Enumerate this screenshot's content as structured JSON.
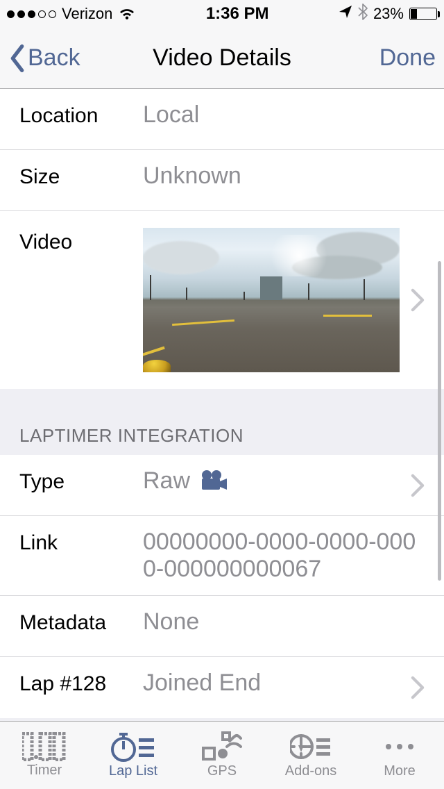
{
  "status": {
    "carrier": "Verizon",
    "time": "1:36 PM",
    "battery_pct": "23%"
  },
  "nav": {
    "back": "Back",
    "title": "Video Details",
    "done": "Done"
  },
  "rows": {
    "location_label": "Location",
    "location_value": "Local",
    "size_label": "Size",
    "size_value": "Unknown",
    "video_label": "Video"
  },
  "section": {
    "laptimer": "LAPTIMER INTEGRATION"
  },
  "integration": {
    "type_label": "Type",
    "type_value": "Raw",
    "link_label": "Link",
    "link_value": "00000000-0000-0000-0000-000000000067",
    "metadata_label": "Metadata",
    "metadata_value": "None",
    "lap_label": "Lap #128",
    "lap_value": "Joined End"
  },
  "tabs": {
    "timer": "Timer",
    "laplist": "Lap List",
    "gps": "GPS",
    "addons": "Add-ons",
    "more": "More"
  }
}
